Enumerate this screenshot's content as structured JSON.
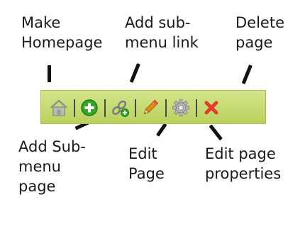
{
  "annotations": {
    "make_homepage": [
      "Make",
      "Homepage"
    ],
    "add_submenu_link": [
      "Add sub-",
      "menu link"
    ],
    "delete_page": [
      "Delete",
      "page"
    ],
    "add_submenu_page": [
      "Add Sub-",
      "menu",
      "page"
    ],
    "edit_page": [
      "Edit",
      "Page"
    ],
    "edit_page_properties": [
      "Edit page",
      "properties"
    ]
  },
  "toolbar": {
    "background": "#c7dc70",
    "icons": [
      "home-icon",
      "add-circle-icon",
      "link-icon",
      "pencil-icon",
      "gear-icon",
      "close-icon"
    ]
  },
  "colors": {
    "delete": "#e23a2b",
    "add": "#36a52a",
    "pencil": "#e68a1a"
  }
}
